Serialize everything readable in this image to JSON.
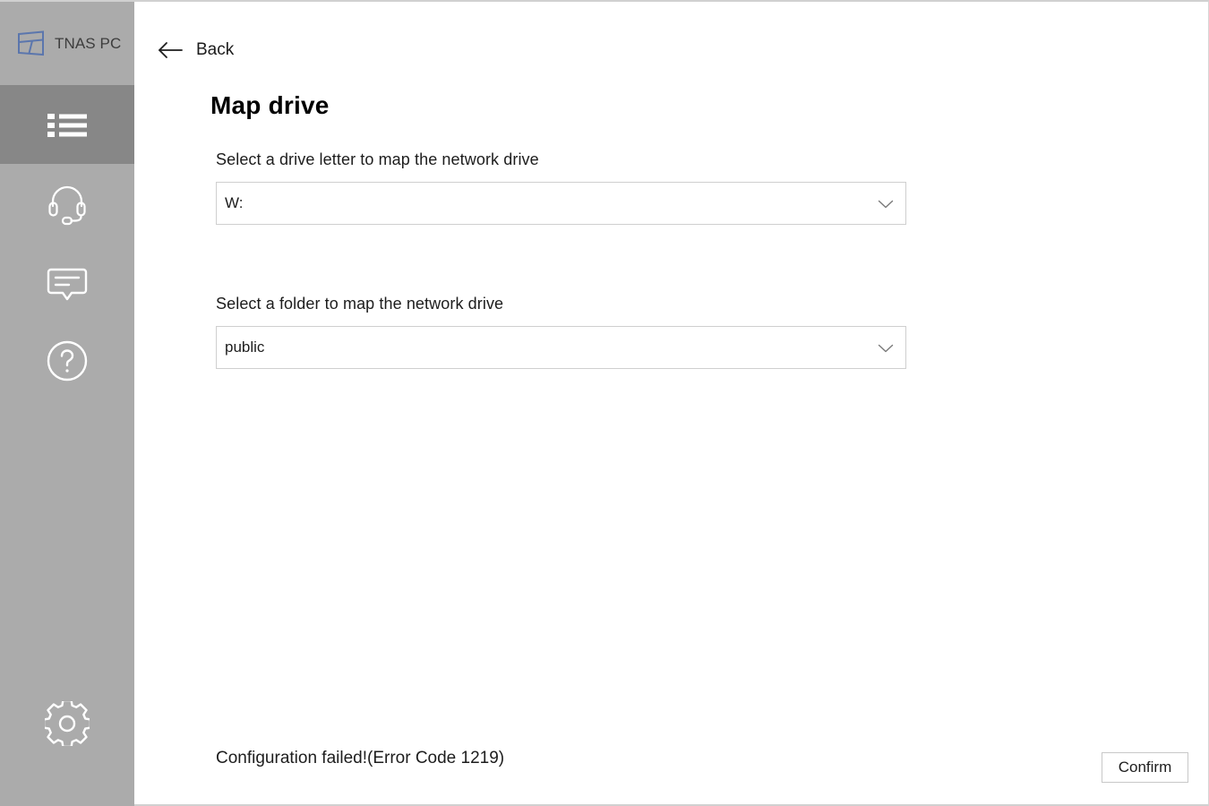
{
  "window": {
    "app_name": "TNAS PC",
    "logo_icon": "tnas-cube-logo",
    "controls": [
      {
        "name": "minimize",
        "icon": "minimize-icon"
      },
      {
        "name": "close",
        "icon": "close-icon"
      }
    ]
  },
  "sidebar": {
    "items": [
      {
        "name": "device-list",
        "icon": "list-icon",
        "active": true
      },
      {
        "name": "support",
        "icon": "headset-icon",
        "active": false
      },
      {
        "name": "feedback",
        "icon": "chat-bubble-icon",
        "active": false
      },
      {
        "name": "help",
        "icon": "question-circle-icon",
        "active": false
      }
    ],
    "bottom_item": {
      "name": "settings",
      "icon": "gear-icon",
      "active": false
    }
  },
  "nav": {
    "back_label": "Back",
    "back_icon": "arrow-left-icon"
  },
  "page": {
    "title": "Map drive"
  },
  "fields": {
    "drive_letter": {
      "label": "Select a drive letter to map the network drive",
      "value": "W:",
      "chevron_icon": "chevron-down-icon"
    },
    "folder": {
      "label": "Select a folder to map the network drive",
      "value": "public",
      "chevron_icon": "chevron-down-icon"
    }
  },
  "footer": {
    "status_message": "Configuration failed!(Error Code 1219)",
    "confirm_label": "Confirm"
  },
  "colors": {
    "sidebar_bg": "#ababab",
    "sidebar_active_bg": "#878787",
    "logo_blue": "#5b76ad",
    "content_bg": "#ffffff",
    "border": "#cfcfcf",
    "text": "#1d1d1d"
  }
}
